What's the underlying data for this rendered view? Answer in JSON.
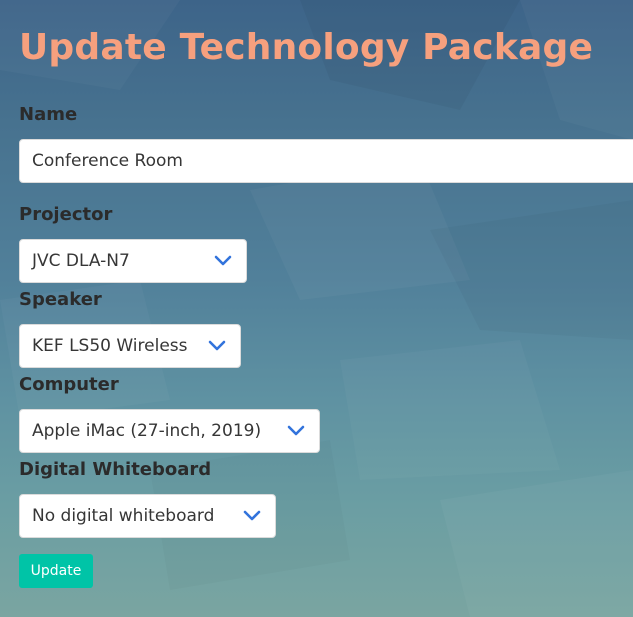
{
  "form": {
    "title": "Update Technology Package",
    "name": {
      "label": "Name",
      "value": "Conference Room"
    },
    "projector": {
      "label": "Projector",
      "value": "JVC DLA-N7",
      "icon": "chevron-down-icon"
    },
    "speaker": {
      "label": "Speaker",
      "value": "KEF LS50 Wireless",
      "icon": "chevron-down-icon"
    },
    "computer": {
      "label": "Computer",
      "value": "Apple iMac (27-inch, 2019)",
      "icon": "chevron-down-icon"
    },
    "whiteboard": {
      "label": "Digital Whiteboard",
      "value": "No digital whiteboard",
      "icon": "chevron-down-icon"
    },
    "submit_label": "Update"
  },
  "colors": {
    "title": "#f6a07e",
    "label": "#2b2b2b",
    "chevron": "#3273dc",
    "button": "#00c4a7",
    "background_top": "#3d6489",
    "background_bottom": "#7aa5a1"
  }
}
